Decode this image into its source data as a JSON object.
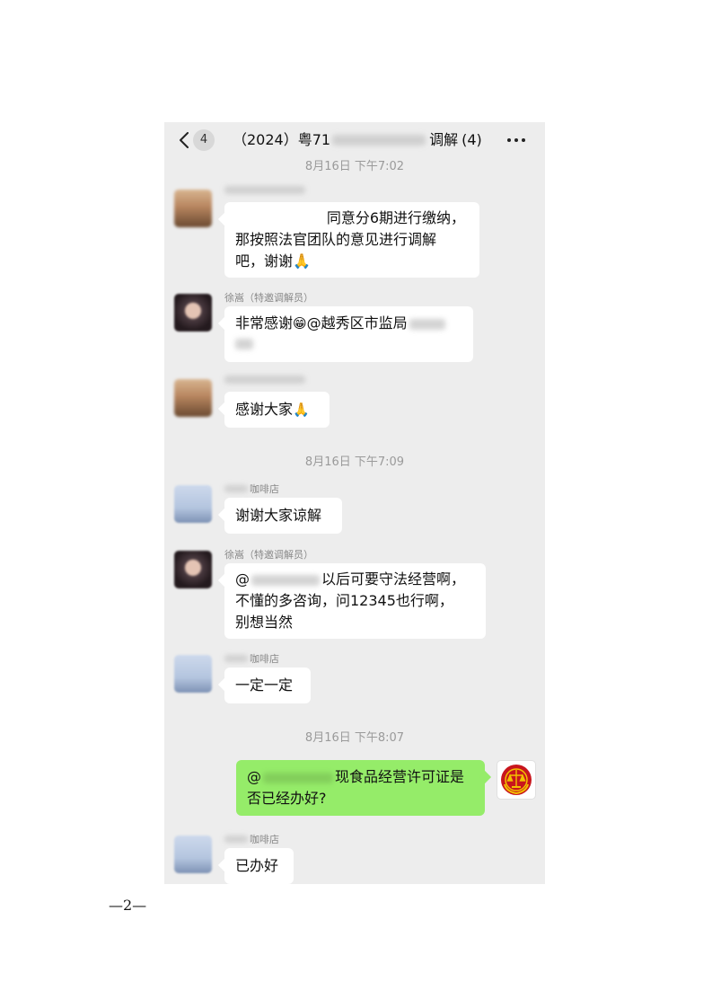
{
  "header": {
    "unread_count": "4",
    "title_prefix": "（2024）粤71",
    "title_suffix": "调解",
    "member_count": "(4)"
  },
  "timestamps": [
    "8月16日 下午7:02",
    "8月16日 下午7:09",
    "8月16日 下午8:07"
  ],
  "messages": [
    {
      "lines": [
        "同意分6期进行缴纳，",
        "那按照法官团队的意见进行调解",
        "吧，谢谢🙏"
      ]
    },
    {
      "sender": "徐嵩（特邀调解员）",
      "text_before": "非常感谢",
      "emoji": "😁",
      "text_after": "@越秀区市监局"
    },
    {
      "text": "感谢大家",
      "emoji": "🙏"
    },
    {
      "sender": "咖啡店",
      "text": "谢谢大家谅解"
    },
    {
      "sender": "徐嵩（特邀调解员）",
      "line1_prefix": "@",
      "line1_text": "以后可要守法经营啊，",
      "line2": "不懂的多咨询，问12345也行啊，",
      "line3": "别想当然"
    },
    {
      "sender": "咖啡店",
      "text": "一定一定"
    },
    {
      "line1_prefix": "@",
      "line1_text": "现食品经营许可证是",
      "line2": "否已经办好?"
    },
    {
      "sender": "咖啡店",
      "text": "已办好"
    }
  ],
  "icons": {
    "back": "chevron-left-icon",
    "more": "more-dots-icon",
    "court": "court-emblem-icon"
  },
  "colors": {
    "chat_background": "#ededed",
    "outgoing_bubble": "#95ec69",
    "incoming_bubble": "#ffffff",
    "emblem_red": "#c8161d",
    "emblem_gold": "#f2c200"
  },
  "footer": {
    "page_number": "—2—"
  }
}
